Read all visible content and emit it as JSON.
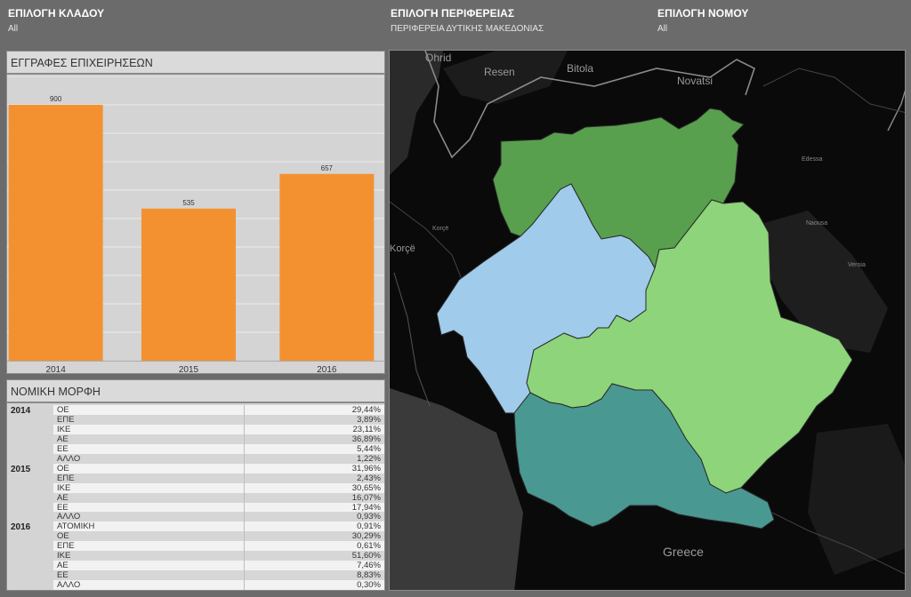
{
  "filters": [
    {
      "title": "ΕΠΙΛΟΓΗ ΚΛΑΔΟΥ",
      "value": "All"
    },
    {
      "title": "ΕΠΙΛΟΓΗ ΠΕΡΙΦΕΡΕΙΑΣ",
      "value": "ΠΕΡΙΦΕΡΕΙΑ ΔΥΤΙΚΗΣ ΜΑΚΕΔΟΝΙΑΣ"
    },
    {
      "title": "ΕΠΙΛΟΓΗ ΝΟΜΟΥ",
      "value": "All"
    }
  ],
  "chart_panel": {
    "title": "ΕΓΓΡΑΦΕΣ ΕΠΙΧΕΙΡΗΣΕΩΝ"
  },
  "chart_data": {
    "type": "bar",
    "categories": [
      "2014",
      "2015",
      "2016"
    ],
    "values": [
      900,
      535,
      657
    ],
    "ylim": [
      0,
      1000
    ],
    "grid": true,
    "bar_color": "#f39131"
  },
  "table_panel": {
    "title": "ΝΟΜΙΚΗ ΜΟΡΦΗ",
    "groups": [
      {
        "year": "2014",
        "rows": [
          {
            "form": "ΟΕ",
            "pct": "29,44%"
          },
          {
            "form": "ΕΠΕ",
            "pct": "3,89%"
          },
          {
            "form": "ΙΚΕ",
            "pct": "23,11%"
          },
          {
            "form": "ΑΕ",
            "pct": "36,89%"
          },
          {
            "form": "ΕΕ",
            "pct": "5,44%"
          },
          {
            "form": "ΑΛΛΟ",
            "pct": "1,22%"
          }
        ]
      },
      {
        "year": "2015",
        "rows": [
          {
            "form": "ΟΕ",
            "pct": "31,96%"
          },
          {
            "form": "ΕΠΕ",
            "pct": "2,43%"
          },
          {
            "form": "ΙΚΕ",
            "pct": "30,65%"
          },
          {
            "form": "ΑΕ",
            "pct": "16,07%"
          },
          {
            "form": "ΕΕ",
            "pct": "17,94%"
          },
          {
            "form": "ΑΛΛΟ",
            "pct": "0,93%"
          }
        ]
      },
      {
        "year": "2016",
        "rows": [
          {
            "form": "ΑΤΟΜΙΚΗ",
            "pct": "0,91%"
          },
          {
            "form": "ΟΕ",
            "pct": "30,29%"
          },
          {
            "form": "ΕΠΕ",
            "pct": "0,61%"
          },
          {
            "form": "ΙΚΕ",
            "pct": "51,60%"
          },
          {
            "form": "ΑΕ",
            "pct": "7,46%"
          },
          {
            "form": "ΕΕ",
            "pct": "8,83%"
          },
          {
            "form": "ΑΛΛΟ",
            "pct": "0,30%"
          }
        ]
      }
    ]
  },
  "map": {
    "labels": {
      "ohrid": "Ohrid",
      "resen": "Resen",
      "bitola": "Bitola",
      "novatsi": "Novatsi",
      "korce": "Korçë",
      "greece": "Greece",
      "edessa": "Edessa",
      "naousa": "Naousa",
      "veroia": "Veroia",
      "korca_small": "Korçë"
    },
    "colors": {
      "florina": "#58a04d",
      "kastoria": "#a0cbea",
      "kozani": "#8dd47a",
      "grevena": "#4a9892",
      "background": "#0a0a0a",
      "terrain": "#2b2b2b"
    }
  }
}
